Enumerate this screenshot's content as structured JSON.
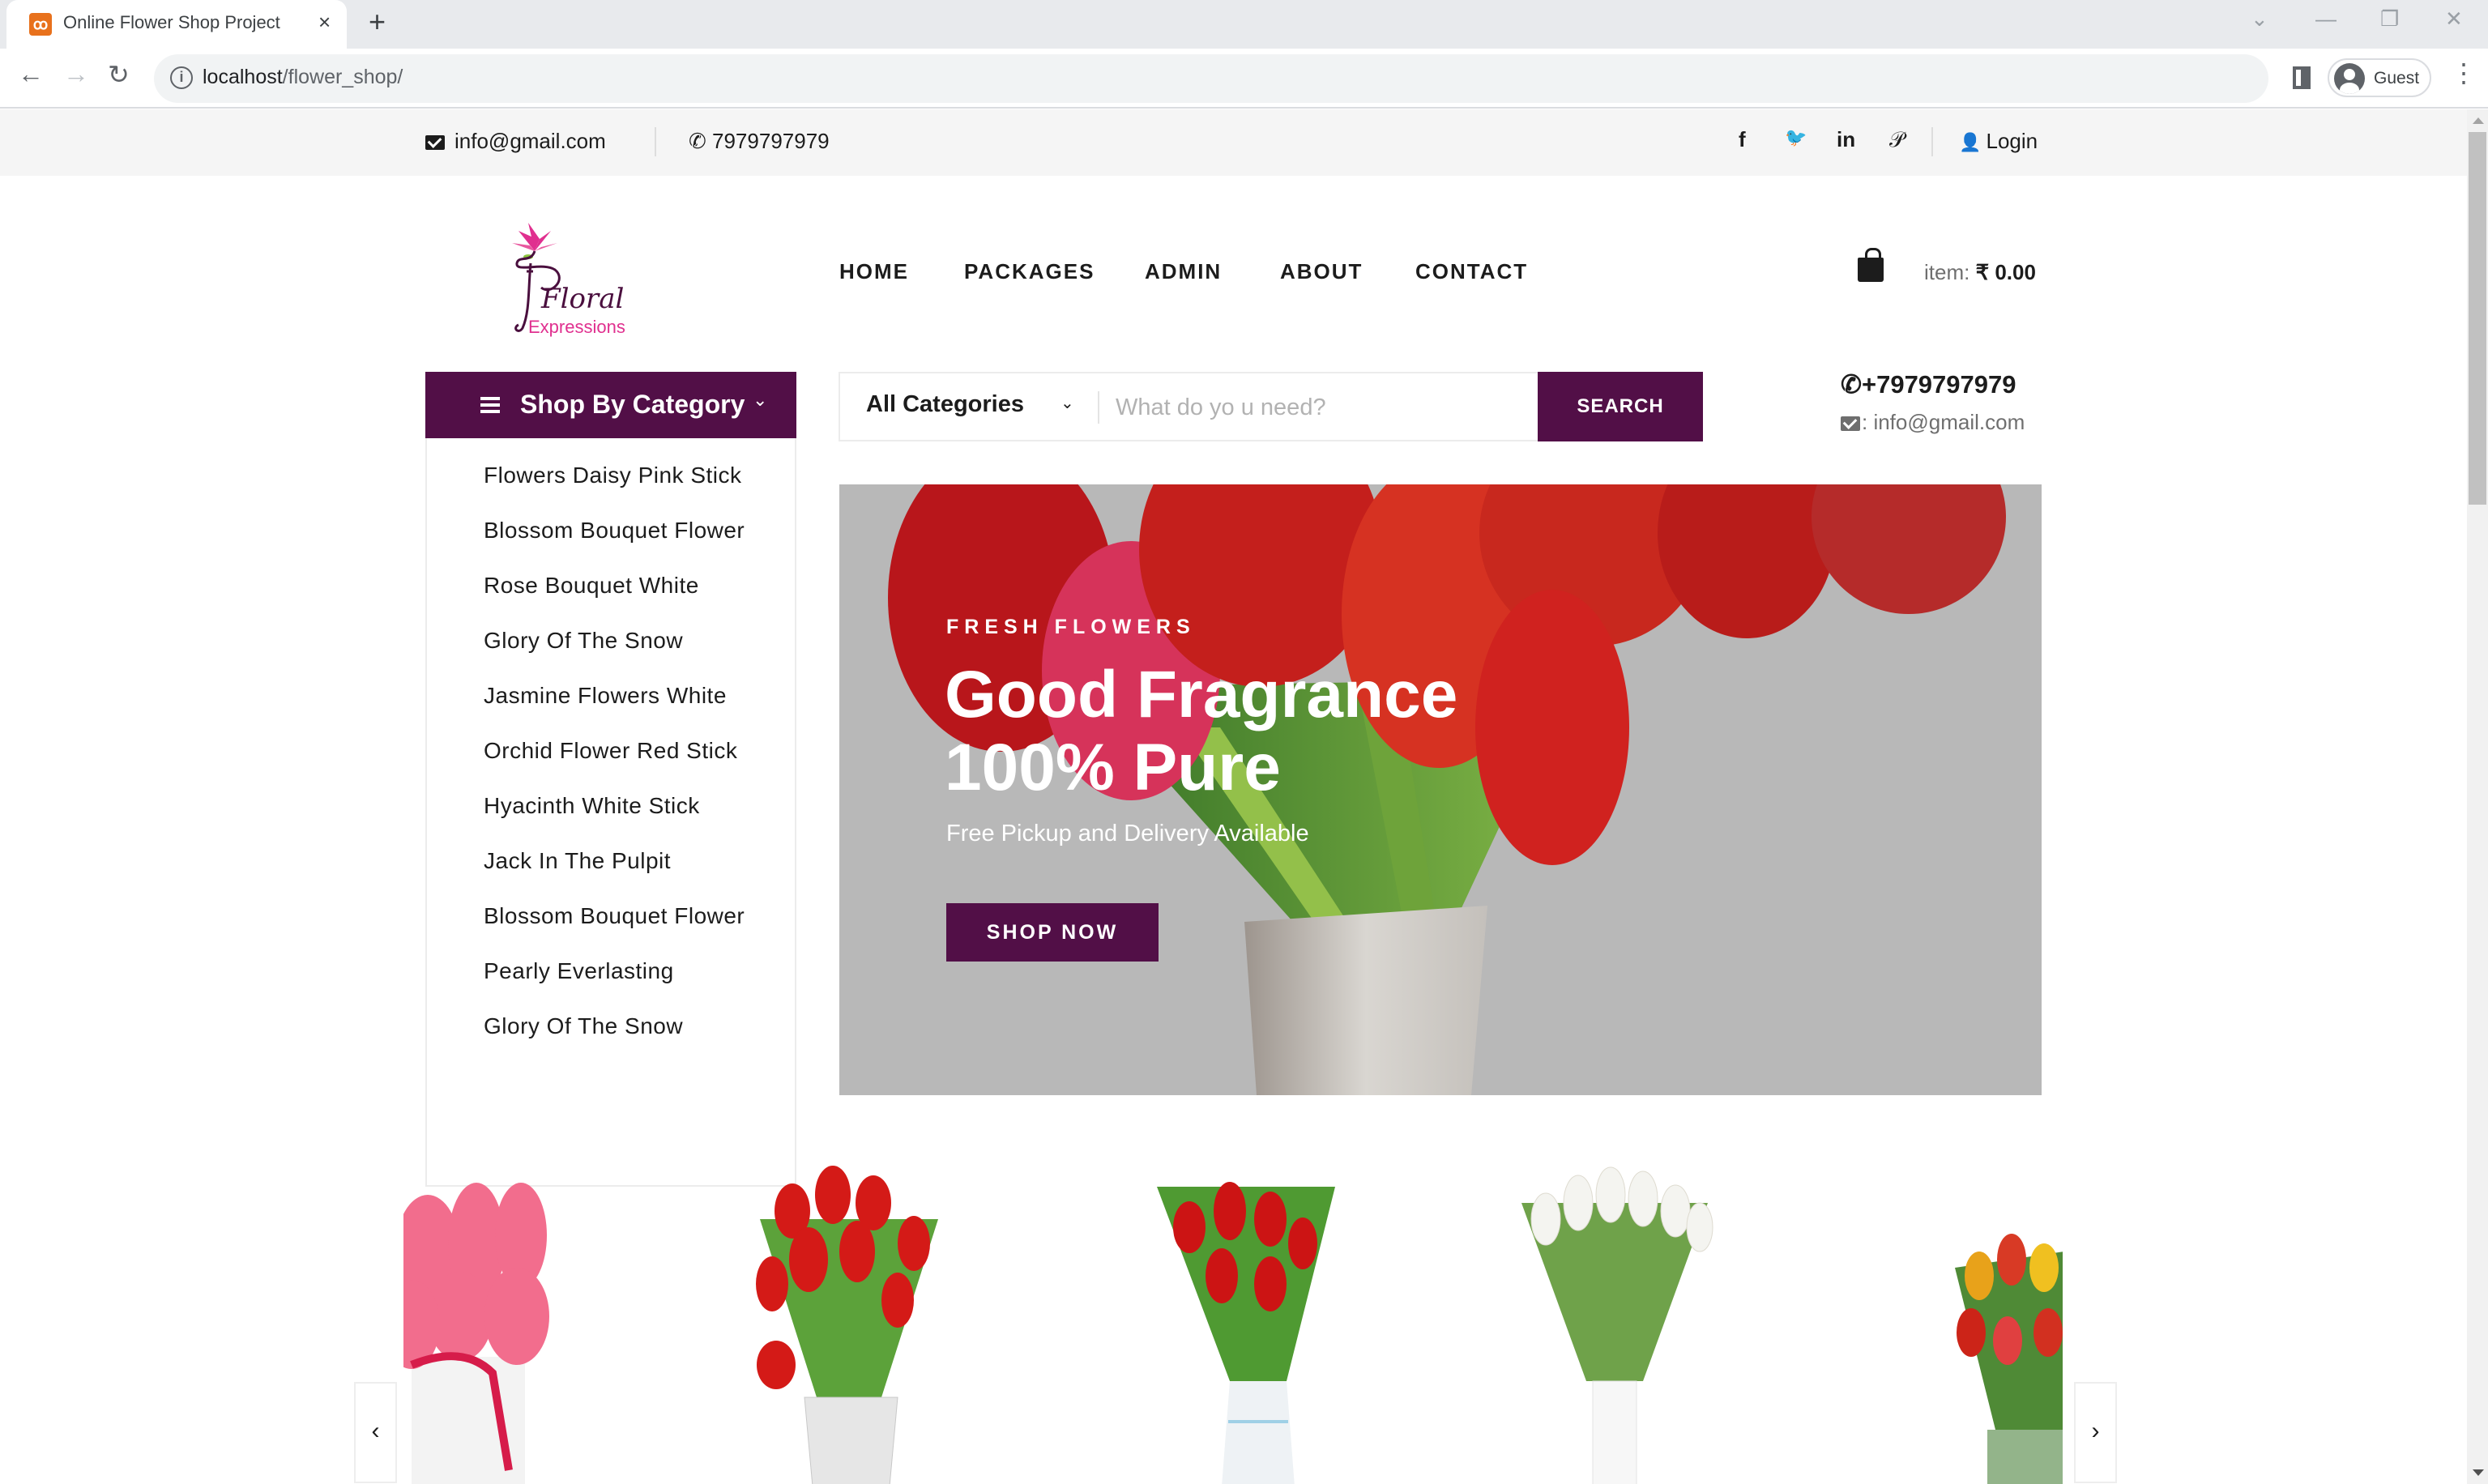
{
  "browser": {
    "tab_title": "Online Flower Shop Project",
    "tab_close": "×",
    "new_tab": "+",
    "url_host": "localhost",
    "url_path": "/flower_shop/",
    "profile_name": "Guest",
    "window_controls": {
      "tab_search": "⌄",
      "minimize": "—",
      "restore": "❐",
      "close": "✕"
    }
  },
  "topbar": {
    "email": "info@gmail.com",
    "phone": "7979797979",
    "social": [
      {
        "name": "facebook",
        "glyph": "f"
      },
      {
        "name": "twitter",
        "glyph": "🐦"
      },
      {
        "name": "linkedin",
        "glyph": "in"
      },
      {
        "name": "pinterest",
        "glyph": "𝒫"
      }
    ],
    "login_label": "Login"
  },
  "brand": {
    "logo_line1": "Floral",
    "logo_line2": "Expressions",
    "colors": {
      "primary": "#520f47",
      "logo_pink": "#e0308f",
      "logo_plum": "#4a0f3e"
    }
  },
  "nav": {
    "items": [
      "HOME",
      "PACKAGES",
      "ADMIN",
      "ABOUT",
      "CONTACT"
    ]
  },
  "cart": {
    "label": "item:",
    "amount": "₹ 0.00"
  },
  "categories": {
    "title": "Shop By Category",
    "items": [
      "Flowers Daisy Pink Stick",
      "Blossom Bouquet Flower",
      "Rose Bouquet White",
      "Glory Of The Snow",
      "Jasmine Flowers White",
      "Orchid Flower Red Stick",
      "Hyacinth White Stick",
      "Jack In The Pulpit",
      "Blossom Bouquet Flower",
      "Pearly Everlasting",
      "Glory Of The Snow"
    ]
  },
  "search": {
    "category_selected": "All Categories",
    "placeholder": "What do yo u need?",
    "value": "",
    "button_label": "SEARCH"
  },
  "contact_box": {
    "phone": "+7979797979",
    "email": ": info@gmail.com"
  },
  "hero": {
    "kicker": "FRESH FLOWERS",
    "title_line1": "Good Fragrance",
    "title_line2": "100% Pure",
    "subtitle": "Free Pickup and Delivery Available",
    "button_label": "SHOP NOW"
  },
  "carousel": {
    "prev": "‹",
    "next": "›",
    "items": [
      {
        "name": "pink-tulips-white-vase",
        "flower_color": "#f26d8d"
      },
      {
        "name": "red-tulips-metal-bucket",
        "flower_color": "#d41a17"
      },
      {
        "name": "red-tulips-glass-vase",
        "flower_color": "#cc1414"
      },
      {
        "name": "white-tulips-white-vase",
        "flower_color": "#f4f4f0"
      },
      {
        "name": "mixed-tulips-green-pot",
        "flower_color": "#e8a21a"
      }
    ]
  }
}
